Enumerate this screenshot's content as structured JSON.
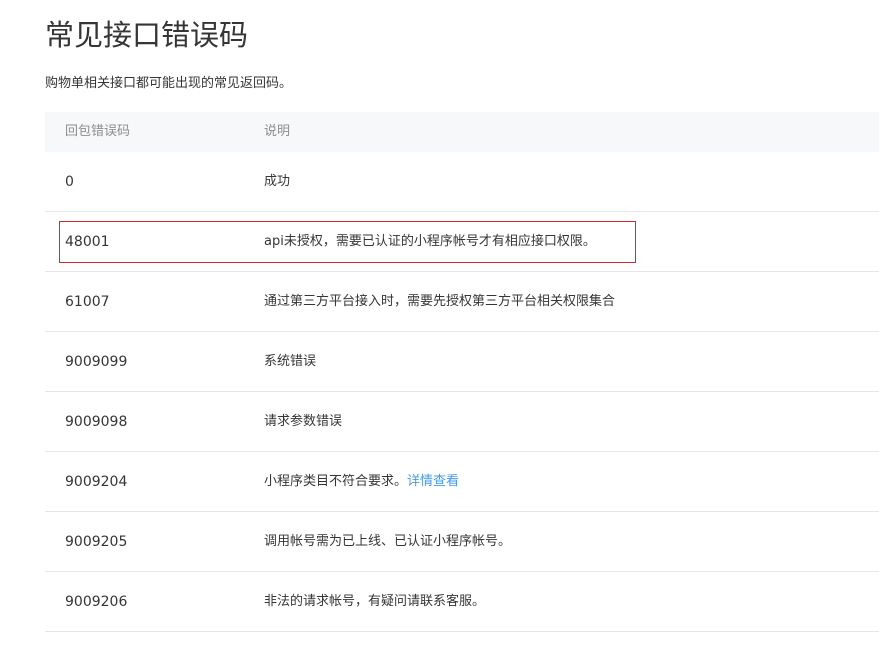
{
  "page": {
    "title": "常见接口错误码",
    "description": "购物单相关接口都可能出现的常见返回码。"
  },
  "table": {
    "headers": {
      "code": "回包错误码",
      "desc": "说明"
    },
    "rows": [
      {
        "code": "0",
        "desc": "成功"
      },
      {
        "code": "48001",
        "desc": "api未授权，需要已认证的小程序帐号才有相应接口权限。"
      },
      {
        "code": "61007",
        "desc": "通过第三方平台接入时，需要先授权第三方平台相关权限集合"
      },
      {
        "code": "9009099",
        "desc": "系统错误"
      },
      {
        "code": "9009098",
        "desc": "请求参数错误"
      },
      {
        "code": "9009204",
        "desc": "小程序类目不符合要求。",
        "link": "详情查看"
      },
      {
        "code": "9009205",
        "desc": "调用帐号需为已上线、已认证小程序帐号。"
      },
      {
        "code": "9009206",
        "desc": "非法的请求帐号，有疑问请联系客服。"
      }
    ]
  },
  "colors": {
    "highlight_border": "#d9262c",
    "link": "#459ae9",
    "header_bg": "#f6f8f9"
  }
}
